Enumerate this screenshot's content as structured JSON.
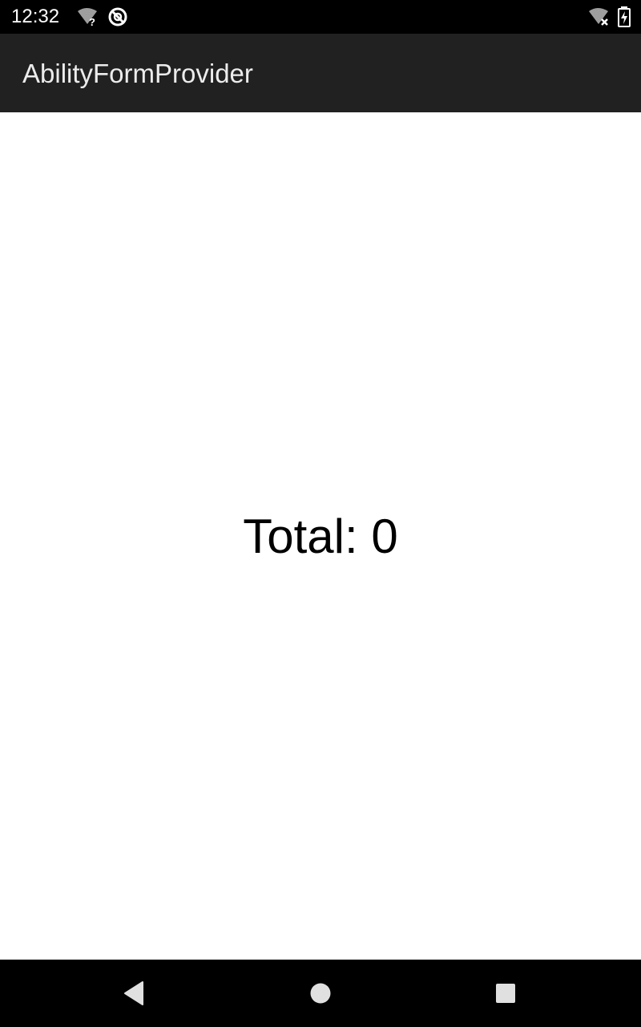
{
  "status_bar": {
    "time": "12:32",
    "icons": [
      "wifi-unknown-icon",
      "sync-disabled-icon",
      "wifi-off-icon",
      "battery-charging-icon"
    ]
  },
  "app_bar": {
    "title": "AbilityFormProvider"
  },
  "main": {
    "total_label": "Total: 0"
  },
  "nav_bar": {
    "buttons": [
      "back-icon",
      "home-icon",
      "recents-icon"
    ]
  },
  "colors": {
    "status_bar": "#000000",
    "app_bar": "#212121",
    "background": "#ffffff",
    "nav_bar": "#000000"
  }
}
